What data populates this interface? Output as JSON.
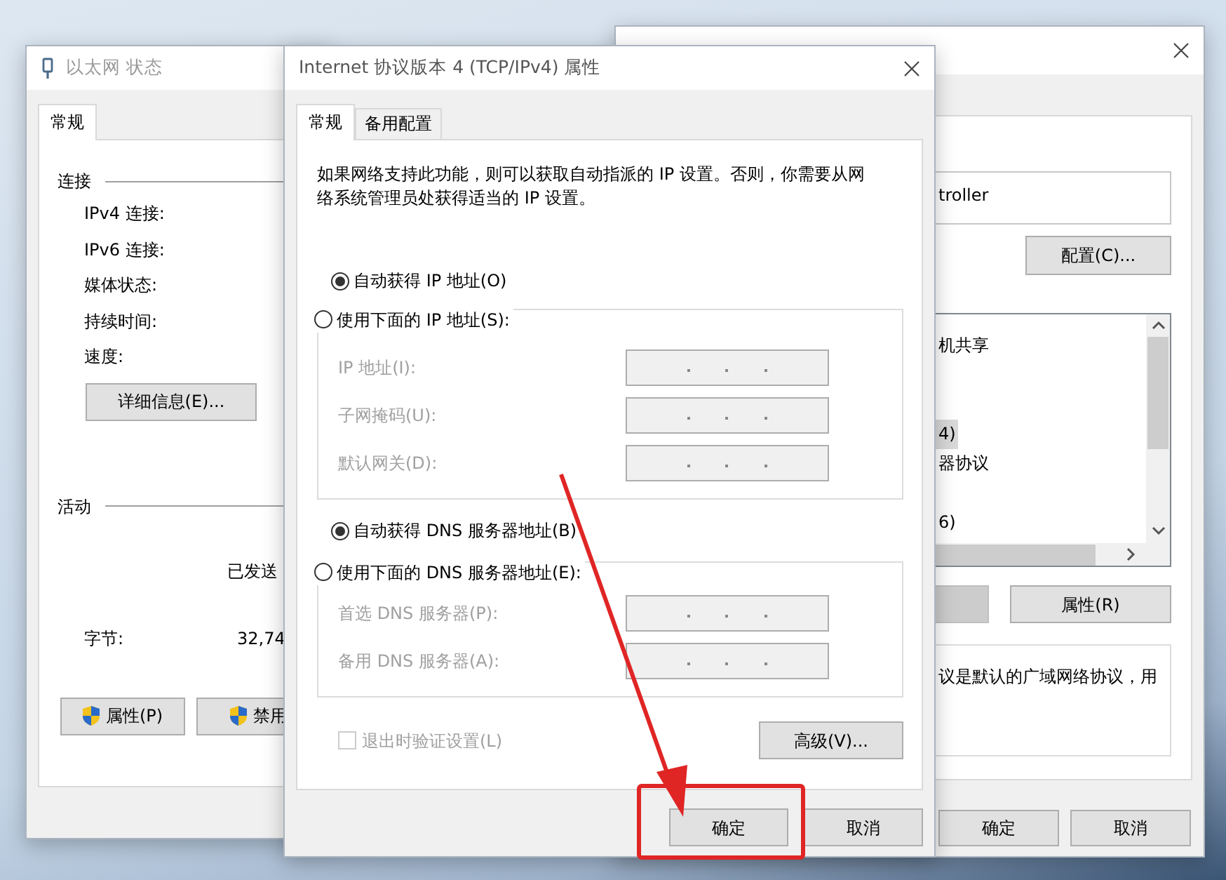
{
  "status_window": {
    "title": "以太网 状态",
    "active": false,
    "tabs": [
      {
        "label": "常规",
        "selected": true
      }
    ],
    "connection_heading": "连接",
    "connection_labels": [
      "IPv4 连接:",
      "IPv6 连接:",
      "媒体状态:",
      "持续时间:",
      "速度:"
    ],
    "details_button": "详细信息(E)...",
    "activity_heading": "活动",
    "sent_header": "已发送",
    "bytes_label": "字节:",
    "bytes_sent": "32,74",
    "buttons": [
      {
        "label": "属性(P)",
        "shield": true
      },
      {
        "label": "禁用",
        "shield": true
      }
    ]
  },
  "properties_window": {
    "adapter_text": "troller",
    "configure_button": "配置(C)...",
    "items": [
      {
        "label": "机共享",
        "selected": false
      },
      {
        "label": "4)",
        "selected": true
      },
      {
        "label": "器协议",
        "selected": false
      },
      {
        "label": "6)",
        "selected": false
      }
    ],
    "properties_button": "属性(R)",
    "description": "议是默认的广域网络协议，用",
    "buttons": [
      "确定",
      "取消"
    ]
  },
  "ipv4_dialog": {
    "title": "Internet 协议版本 4 (TCP/IPv4) 属性",
    "active": true,
    "tabs": [
      {
        "label": "常规",
        "selected": true
      },
      {
        "label": "备用配置",
        "selected": false
      }
    ],
    "intro": "如果网络支持此功能，则可以获取自动指派的 IP 设置。否则，你需要从网络系统管理员处获得适当的 IP 设置。",
    "ip_options": [
      {
        "label": "自动获得 IP 地址(O)",
        "selected": true
      },
      {
        "label": "使用下面的 IP 地址(S):",
        "selected": false
      }
    ],
    "ip_fields": [
      {
        "label": "IP 地址(I):",
        "disabled": true
      },
      {
        "label": "子网掩码(U):",
        "disabled": true
      },
      {
        "label": "默认网关(D):",
        "disabled": true
      }
    ],
    "dns_options": [
      {
        "label": "自动获得 DNS 服务器地址(B)",
        "selected": true
      },
      {
        "label": "使用下面的 DNS 服务器地址(E):",
        "selected": false
      }
    ],
    "dns_fields": [
      {
        "label": "首选 DNS 服务器(P):",
        "disabled": true
      },
      {
        "label": "备用 DNS 服务器(A):",
        "disabled": true
      }
    ],
    "validate_checkbox": {
      "label": "退出时验证设置(L)",
      "checked": false,
      "disabled": true
    },
    "advanced_button": "高级(V)...",
    "buttons": [
      "确定",
      "取消"
    ]
  },
  "annotation": {
    "arrow": true,
    "highlight_frame": true
  }
}
